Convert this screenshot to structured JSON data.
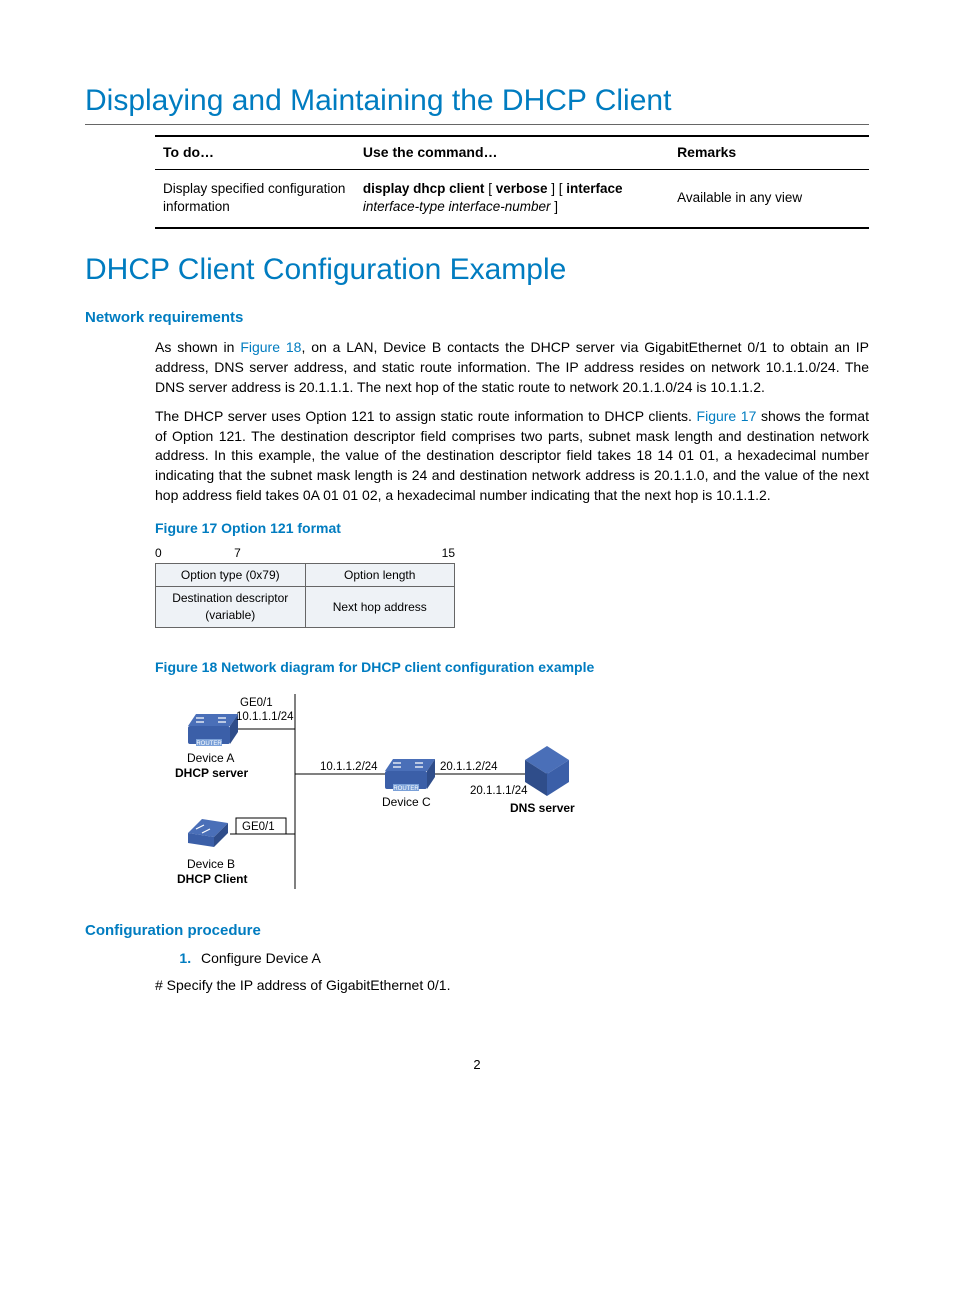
{
  "h1a": "Displaying and Maintaining the DHCP Client",
  "table": {
    "th1": "To do…",
    "th2": "Use the command…",
    "th3": "Remarks",
    "td1": "Display specified configuration information",
    "cmd": {
      "p1": "display dhcp client",
      "p2": " [ ",
      "p3": "verbose",
      "p4": " ] [ ",
      "p5": "interface",
      "p6": "interface-type interface-number",
      "p7": " ]"
    },
    "td3": "Available in any view"
  },
  "h1b": "DHCP Client Configuration Example",
  "h3a": "Network requirements",
  "para1": {
    "t1": "As shown in ",
    "link": "Figure 18",
    "t2": ", on a LAN, Device B contacts the DHCP server via GigabitEthernet 0/1 to obtain an IP address, DNS server address, and static route information. The IP address resides on network 10.1.1.0/24. The DNS server address is 20.1.1.1. The next hop of the static route to network 20.1.1.0/24 is 10.1.1.2."
  },
  "para2": {
    "t1": "The DHCP server uses Option 121 to assign static route information to DHCP clients. ",
    "link": "Figure 17",
    "t2": " shows the format of Option 121. The destination descriptor field comprises two parts, subnet mask length and destination network address. In this example, the value of the destination descriptor field takes 18 14 01 01, a hexadecimal number indicating that the subnet mask length is 24 and destination network address is 20.1.1.0, and the value of the next hop address field takes 0A 01 01 02, a hexadecimal number indicating that the next hop is 10.1.1.2."
  },
  "fig17": {
    "caption": "Figure 17 Option 121 format",
    "r0": "0",
    "r7": "7",
    "r15": "15",
    "c1": "Option type (0x79)",
    "c2": "Option length",
    "c3a": "Destination descriptor",
    "c3b": "(variable)",
    "c4": "Next hop address"
  },
  "fig18": {
    "caption": "Figure 18 Network diagram for DHCP client configuration example",
    "ge01a": "GE0/1",
    "ip_a": "10.1.1.1/24",
    "devA": "Device A",
    "dhcpServer": "DHCP server",
    "ge01b": "GE0/1",
    "devB": "Device B",
    "dhcpClient": "DHCP Client",
    "ip_c_left": "10.1.1.2/24",
    "ip_c_right": "20.1.1.2/24",
    "devC": "Device C",
    "ip_dns": "20.1.1.1/24",
    "dnsServer": "DNS server",
    "routerWord": "ROUTER"
  },
  "h3b": "Configuration procedure",
  "step1": "Configure Device A",
  "hash": "# Specify the IP address of GigabitEthernet 0/1.",
  "pageNumber": "2"
}
